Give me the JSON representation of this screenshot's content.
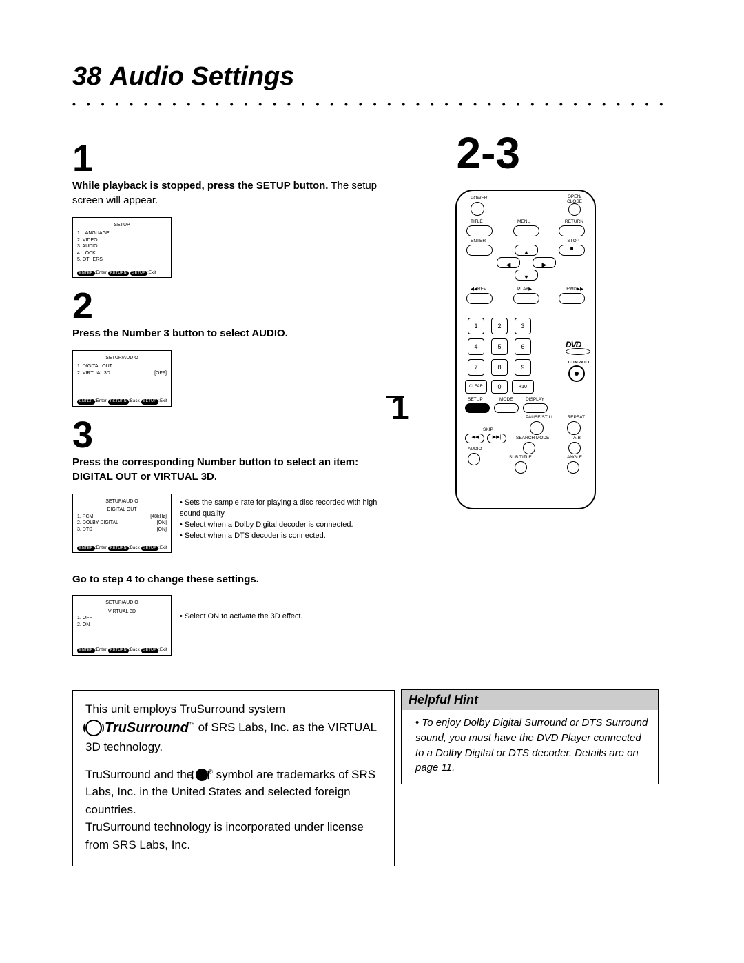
{
  "header": {
    "page_number": "38",
    "title": "Audio Settings"
  },
  "step1": {
    "num": "1",
    "text_bold": "While playback is stopped, press the SETUP button.",
    "text_rest": " The setup screen will appear.",
    "menu": {
      "title": "SETUP",
      "items": [
        "1. LANGUAGE",
        "2. VIDEO",
        "3. AUDIO",
        "4. LOCK",
        "5. OTHERS"
      ],
      "footer_enter": "ENTER",
      "footer_enter_lbl": ":Enter",
      "footer_ret": "RETURN",
      "footer_setup": "SETUP",
      "footer_exit": ":Exit"
    }
  },
  "step2": {
    "num": "2",
    "text_bold": "Press the Number 3 button to select AUDIO.",
    "menu": {
      "title": "SETUP/AUDIO",
      "rows": [
        {
          "l": "1. DIGITAL OUT",
          "r": ""
        },
        {
          "l": "2. VIRTUAL 3D",
          "r": "[OFF]"
        }
      ],
      "footer_enter": "ENTER",
      "footer_enter_lbl": ":Enter",
      "footer_ret": "RETURN",
      "footer_ret_lbl": ":Back",
      "footer_setup": "SETUP",
      "footer_exit": ":Exit"
    }
  },
  "step3": {
    "num": "3",
    "text_bold": "Press the corresponding Number button to select an item: DIGITAL OUT or VIRTUAL 3D.",
    "menu1": {
      "title": "SETUP/AUDIO",
      "sub": "DIGITAL OUT",
      "rows": [
        {
          "l": "1. PCM",
          "r": "[48kHz]"
        },
        {
          "l": "2. DOLBY DIGITAL",
          "r": "[ON]"
        },
        {
          "l": "3. DTS",
          "r": "[ON]"
        }
      ],
      "bullets": [
        "Sets the sample rate for playing a disc recorded with high sound quality.",
        "Select when a Dolby Digital decoder is connected.",
        "Select when a DTS decoder is connected."
      ],
      "footer_enter": "ENTER",
      "footer_enter_lbl": ":Enter",
      "footer_ret": "RETURN",
      "footer_ret_lbl": ":Back",
      "footer_setup": "SETUP",
      "footer_exit": ":Exit"
    },
    "goto": "Go to step 4 to change these settings.",
    "menu2": {
      "title": "SETUP/AUDIO",
      "sub": "VIRTUAL 3D",
      "rows": [
        {
          "l": "1. OFF",
          "r": ""
        },
        {
          "l": "2. ON",
          "r": ""
        }
      ],
      "bullets": [
        "Select ON to activate the 3D effect."
      ],
      "footer_enter": "ENTER",
      "footer_enter_lbl": ":Enter",
      "footer_ret": "RETURN",
      "footer_ret_lbl": ":Back",
      "footer_setup": "SETUP",
      "footer_exit": ":Exit"
    }
  },
  "tru_box": {
    "line1": "This unit employs TruSurround system",
    "logo_text": "TruSurround",
    "line2": " of SRS Labs, Inc. as the VIRTUAL 3D technology.",
    "para2a": "TruSurround and the",
    "para2b": " symbol are trademarks of SRS Labs, Inc. in the United States and selected foreign countries.",
    "para3": "TruSurround technology is incorporated under license from SRS Labs, Inc."
  },
  "hint": {
    "title": "Helpful Hint",
    "body": "To enjoy Dolby Digital Surround or DTS Surround sound, you must have the DVD Player connected to a Dolby Digital or DTS decoder. Details are on page 11."
  },
  "callouts": {
    "right": "2-3",
    "left": "1"
  },
  "remote": {
    "power": "POWER",
    "open": "OPEN/\nCLOSE",
    "title": "TITLE",
    "menu": "MENU",
    "return": "RETURN",
    "enter": "ENTER",
    "stop": "STOP",
    "rev": "◀◀REV",
    "play": "PLAY▶",
    "fwd": "FWD▶▶",
    "nums": [
      "1",
      "2",
      "3",
      "4",
      "5",
      "6",
      "7",
      "8",
      "9"
    ],
    "clear": "CLEAR",
    "zero": "0",
    "plus10": "+10",
    "setup": "SETUP",
    "mode": "MODE",
    "display": "DISPLAY",
    "pause": "PAUSE/STILL",
    "repeat": "REPEAT",
    "skip": "SKIP",
    "search": "SEARCH MODE",
    "ab": "A-B",
    "audio": "AUDIO",
    "subtitle": "SUB TITLE",
    "angle": "ANGLE",
    "dvd": "DVD",
    "compact": "COMPACT"
  }
}
